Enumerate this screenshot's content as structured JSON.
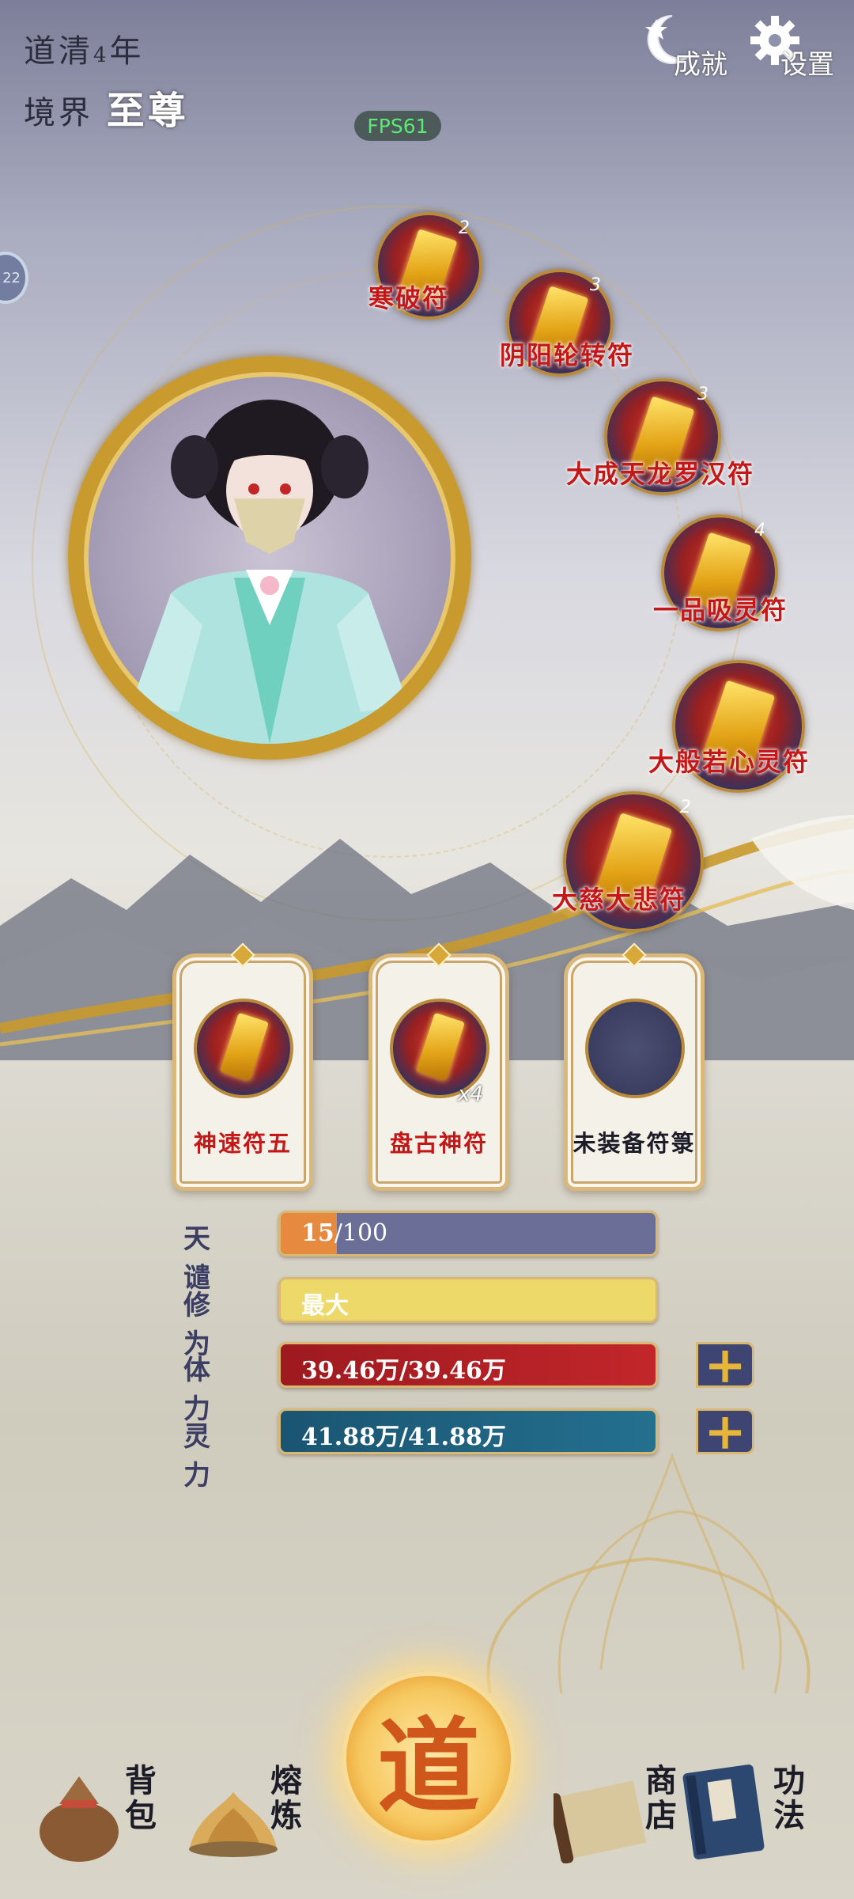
{
  "hud": {
    "era_label": "道清",
    "era_year": "4",
    "era_unit": "年",
    "realm_label": "境界",
    "realm_value": "至尊",
    "fps": "FPS61",
    "side_badge": "22"
  },
  "top_buttons": {
    "achievements": "成就",
    "settings": "设置"
  },
  "talismans": [
    {
      "name": "寒破符",
      "count": "2"
    },
    {
      "name": "阴阳轮转符",
      "count": "3"
    },
    {
      "name": "大成天龙罗汉符",
      "count": "3"
    },
    {
      "name": "一品吸灵符",
      "count": "4"
    },
    {
      "name": "大般若心灵符",
      "count": ""
    },
    {
      "name": "大慈大悲符",
      "count": "2"
    }
  ],
  "slots": [
    {
      "label": "神速符五",
      "count": "",
      "color": "#c41818"
    },
    {
      "label": "盘古神符",
      "count": "x4",
      "color": "#c41818"
    },
    {
      "label": "未装备符箓",
      "count": "",
      "color": "#1c1c28"
    }
  ],
  "stats": {
    "tianqian": {
      "name": "天谴",
      "current": "15",
      "max": "/100",
      "fraction": 0.15
    },
    "xiuwei": {
      "name": "修为",
      "value": "最大"
    },
    "tili": {
      "name": "体力",
      "value": "39.46万/39.46万"
    },
    "lingli": {
      "name": "灵力",
      "value": "41.88万/41.88万"
    }
  },
  "nav": {
    "bag": "背包",
    "smelt": "熔炼",
    "dao": "道",
    "shop": "商店",
    "skills": "功法"
  },
  "colors": {
    "tianqian_bar": "#6b6f98",
    "xiuwei_bar": "#ecd96a",
    "tili_bar": "#b01f24",
    "lingli_bar": "#1f5f7d",
    "gold": "#c99a2e"
  }
}
